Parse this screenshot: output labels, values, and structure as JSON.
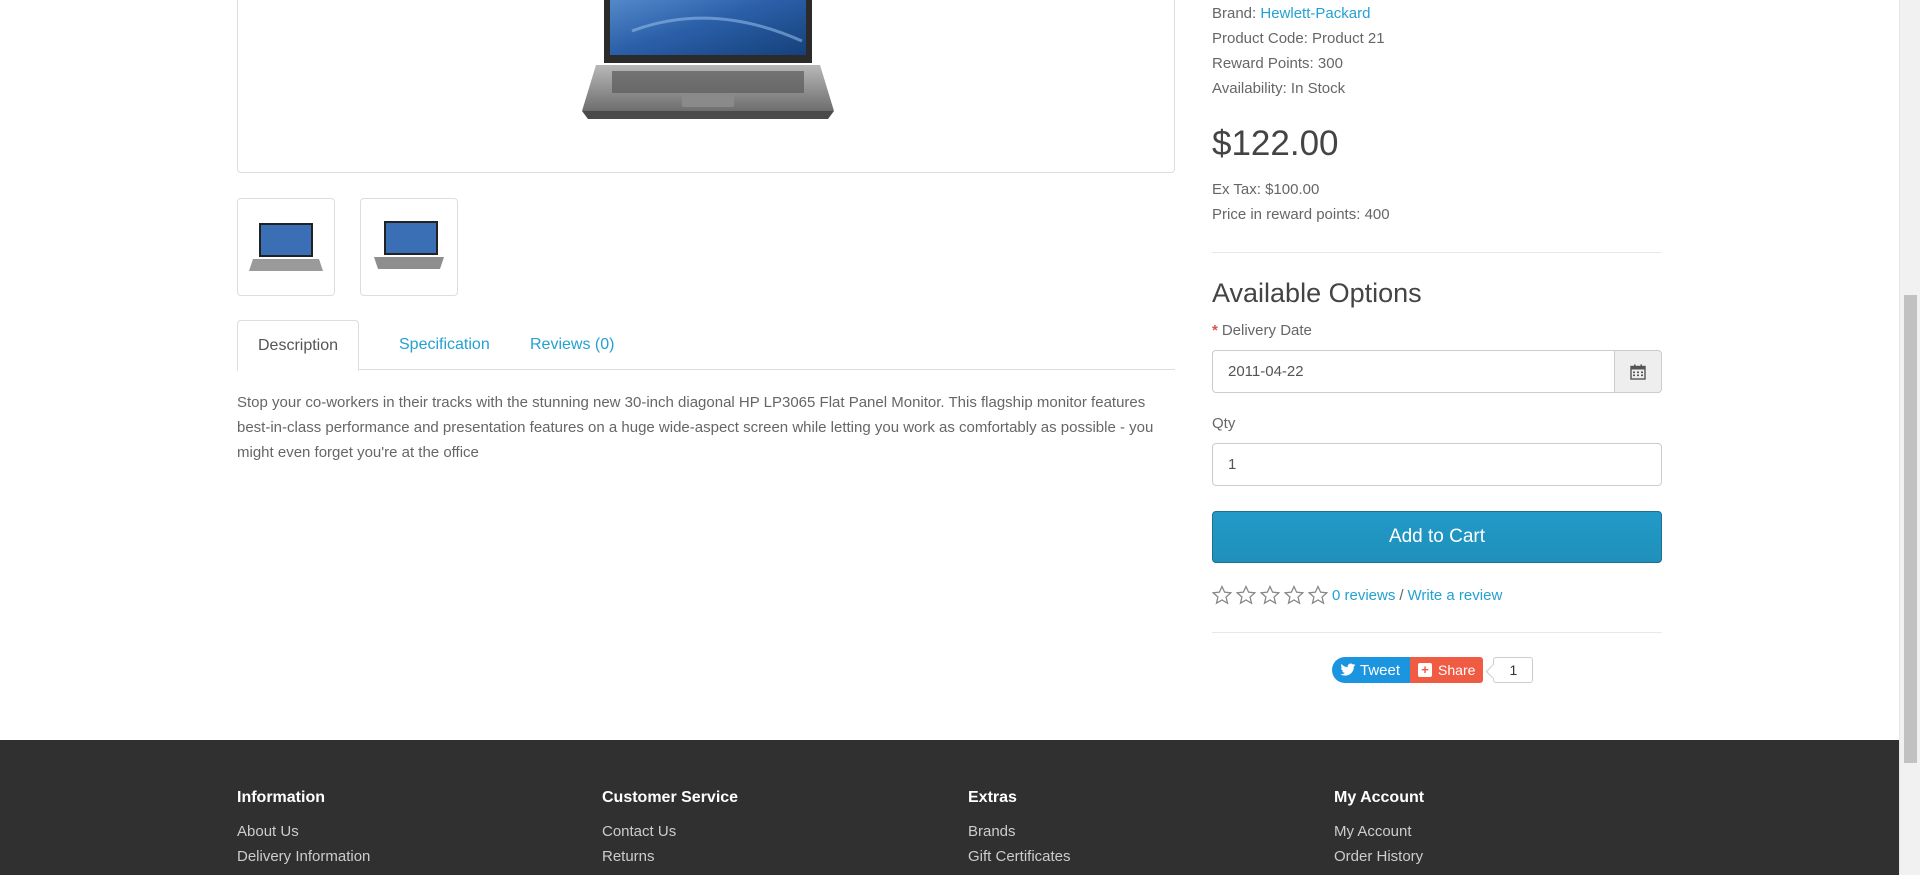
{
  "product": {
    "brand_label": "Brand:",
    "brand_value": "Hewlett-Packard",
    "product_code": "Product Code: Product 21",
    "reward_points": "Reward Points: 300",
    "availability": "Availability: In Stock",
    "price": "$122.00",
    "ex_tax": "Ex Tax: $100.00",
    "price_reward": "Price in reward points: 400"
  },
  "tabs": [
    {
      "label": "Description",
      "active": true
    },
    {
      "label": "Specification",
      "active": false
    },
    {
      "label": "Reviews (0)",
      "active": false
    }
  ],
  "description": "Stop your co-workers in their tracks with the stunning new 30-inch diagonal HP LP3065 Flat Panel Monitor. This flagship monitor features best-in-class performance and presentation features on a huge wide-aspect screen while letting you work as comfortably as possible - you might even forget you're at the office",
  "options": {
    "heading": "Available Options",
    "required_mark": "*",
    "delivery_label": "Delivery Date",
    "delivery_value": "2011-04-22",
    "qty_label": "Qty",
    "qty_value": "1",
    "add_to_cart": "Add to Cart"
  },
  "rating": {
    "stars": 0,
    "max_stars": 5,
    "reviews_link": "0 reviews",
    "separator": "/",
    "write_review": "Write a review"
  },
  "social": {
    "tweet": "Tweet",
    "share": "Share",
    "share_count": "1"
  },
  "footer": {
    "columns": [
      {
        "title": "Information",
        "links": [
          "About Us",
          "Delivery Information"
        ]
      },
      {
        "title": "Customer Service",
        "links": [
          "Contact Us",
          "Returns"
        ]
      },
      {
        "title": "Extras",
        "links": [
          "Brands",
          "Gift Certificates"
        ]
      },
      {
        "title": "My Account",
        "links": [
          "My Account",
          "Order History"
        ]
      }
    ]
  },
  "colors": {
    "link": "#23a1d1",
    "cart_button": "#229ac8",
    "footer_bg": "#303030",
    "tweet": "#1b95e0",
    "share": "#f05b43"
  },
  "icons": [
    "calendar-icon",
    "star-empty-icon",
    "twitter-bird-icon",
    "share-plus-icon"
  ]
}
